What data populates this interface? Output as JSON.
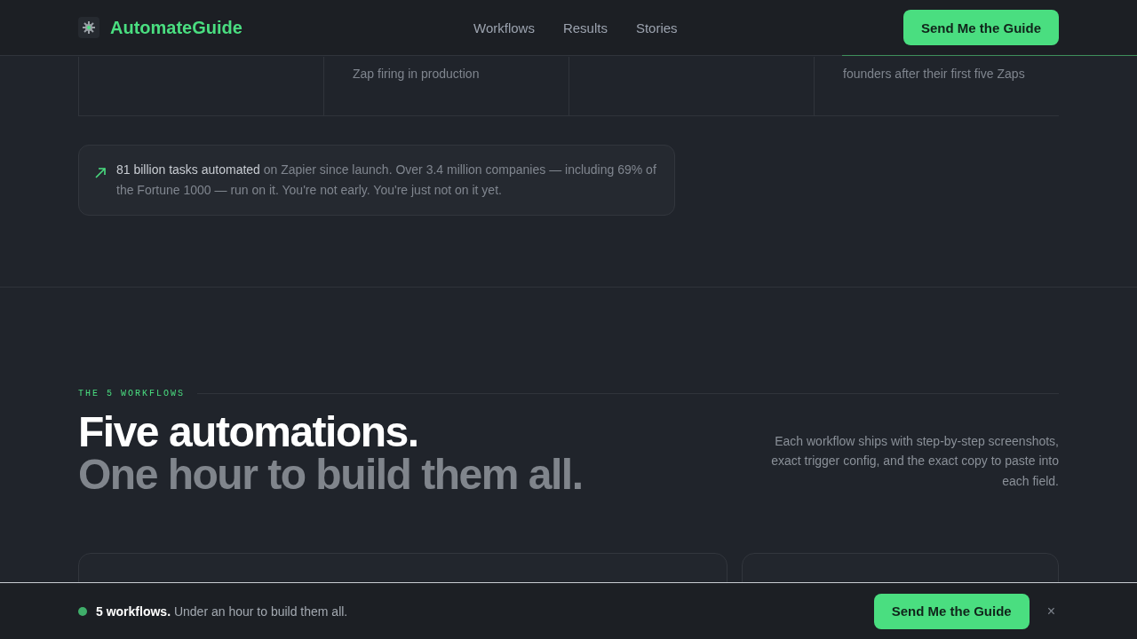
{
  "header": {
    "brand": "AutomateGuide",
    "nav": [
      {
        "label": "Workflows"
      },
      {
        "label": "Results"
      },
      {
        "label": "Stories"
      }
    ],
    "cta": "Send Me the Guide"
  },
  "stats": [
    {
      "kind": "blank"
    },
    {
      "kind": "caption",
      "caption": "Zap firing in production"
    },
    {
      "kind": "blank"
    },
    {
      "kind": "caption",
      "caption": "founders after their first five Zaps"
    }
  ],
  "callout": {
    "text": "**81 billion tasks automated** on Zapier since launch. Over 3.4 million companies — including 69% of the Fortune 1000 — run on it. You're not early. You're just not on it yet."
  },
  "section": {
    "eyebrow": "THE 5 WORKFLOWS",
    "title": "Five automations.",
    "subtitle": "One hour to build them all.",
    "description": "Each workflow ships with step-by-step screenshots, exact trigger config, and the exact copy to paste into each field."
  },
  "bottom_bar": {
    "text": "**5 workflows.** Under an hour to build them all.",
    "cta": "Send Me the Guide",
    "close": "×"
  }
}
